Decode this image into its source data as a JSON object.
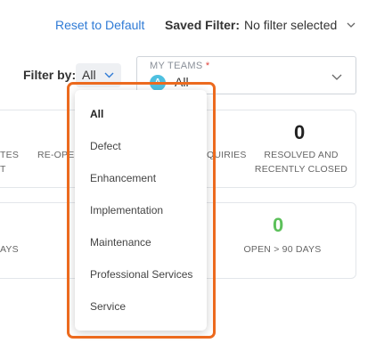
{
  "header": {
    "reset_label": "Reset to Default",
    "saved_filter_label": "Saved Filter:",
    "saved_filter_value": "No filter selected"
  },
  "filter": {
    "label": "Filter by:",
    "value": "All"
  },
  "teams": {
    "label": "MY TEAMS",
    "required_mark": "*",
    "avatar_letter": "A",
    "value": "All"
  },
  "stats_row1": {
    "left_line1": "TES",
    "left_line2": "T",
    "reopened": "RE-OPEN",
    "inquiries": "QUIRIES",
    "resolved_count": "0",
    "resolved_line1": "RESOLVED AND",
    "resolved_line2": "RECENTLY CLOSED"
  },
  "stats_row2": {
    "left": "AYS",
    "open_count": "0",
    "open_label": "OPEN > 90 DAYS"
  },
  "dropdown": {
    "options": [
      "All",
      "Defect",
      "Enhancement",
      "Implementation",
      "Maintenance",
      "Professional Services",
      "Service"
    ],
    "selected": "All"
  },
  "colors": {
    "link": "#2f7bd6",
    "highlight": "#ec6a1e",
    "avatar": "#4ec0e0",
    "open_count": "#5cc05a",
    "required": "#e0433b"
  }
}
